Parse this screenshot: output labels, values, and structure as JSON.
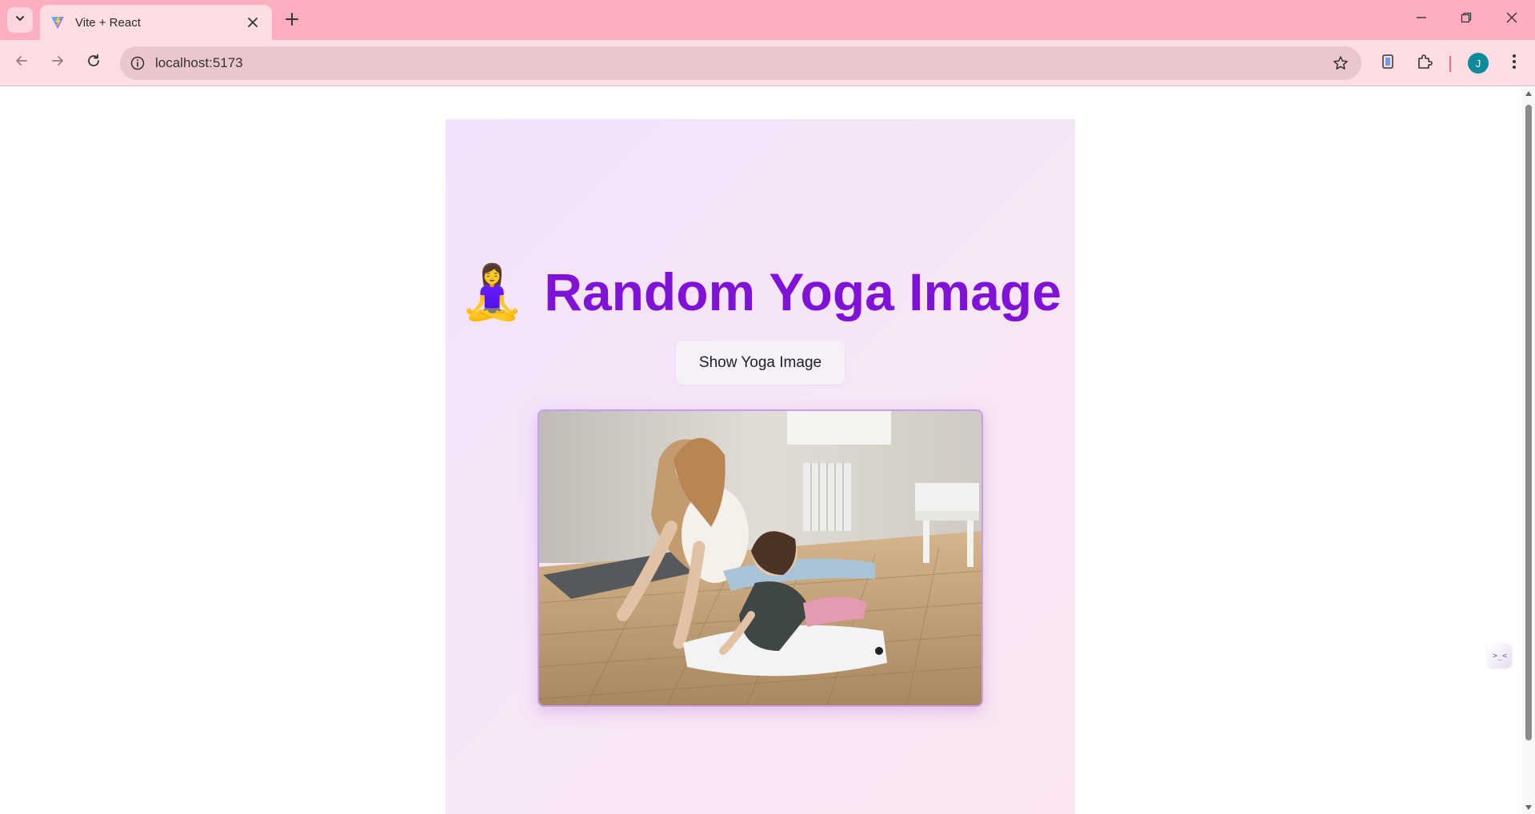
{
  "browser": {
    "tab": {
      "title": "Vite + React",
      "favicon": "vite-logo-icon"
    },
    "address_bar": {
      "url": "localhost:5173"
    },
    "profile_initial": "J",
    "colors": {
      "frame": "#ffadc0",
      "toolbar": "#ffdde5",
      "omnibox": "#ecc6cf",
      "avatar": "#0e8a9a"
    }
  },
  "page": {
    "heading": {
      "emoji": "🧘‍♀️",
      "text": "Random Yoga Image"
    },
    "show_button_label": "Show Yoga Image",
    "image": {
      "subject": "yoga-photo"
    },
    "colors": {
      "heading": "#8011d6",
      "card_gradient_start": "#f2e2fb",
      "card_gradient_end": "#fbe5f1",
      "image_border": "#c99ee8"
    }
  },
  "side_widget": {
    "glyph": ">_<"
  }
}
